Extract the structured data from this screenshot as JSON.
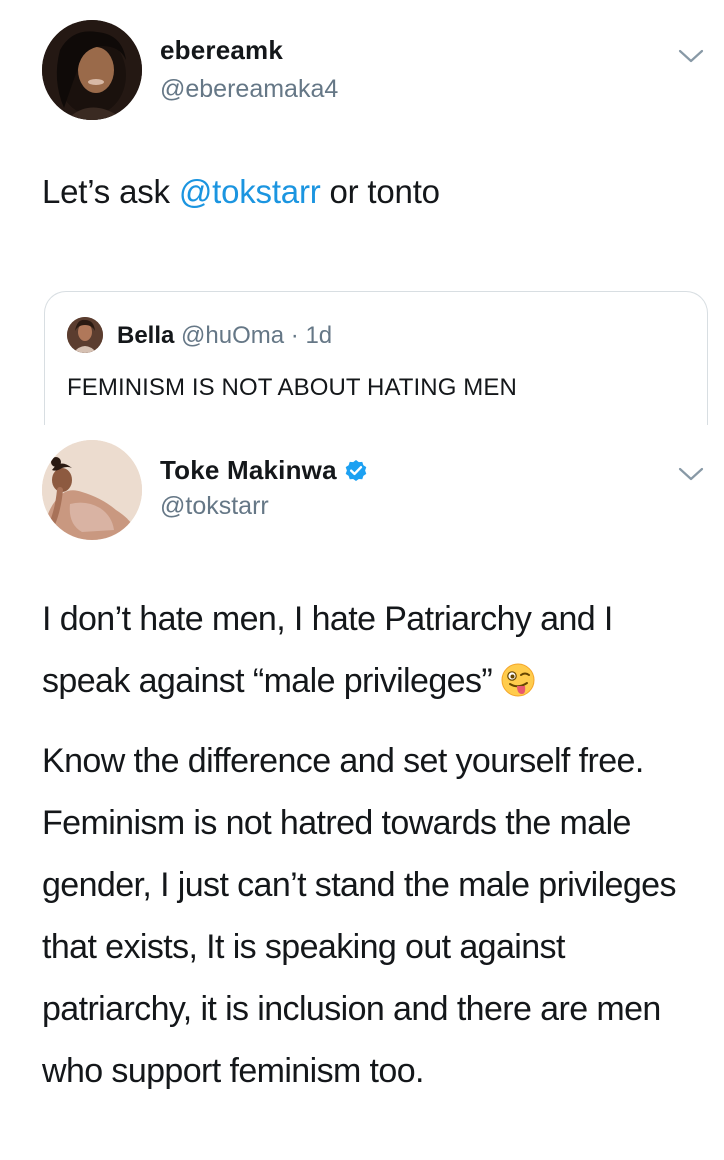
{
  "tweet1": {
    "display_name": "ebereamk",
    "handle": "@ebereamaka4",
    "text_before": "Let’s ask ",
    "mention": "@tokstarr",
    "text_after": " or tonto"
  },
  "quoted": {
    "display_name": "Bella",
    "handle_meta": "@huOma · 1d",
    "text": "FEMINISM IS NOT ABOUT HATING MEN"
  },
  "tweet2": {
    "display_name": "Toke Makinwa",
    "handle": "@tokstarr",
    "paragraph1": "I don’t hate men, I hate Patriarchy and I speak against “male privileges”",
    "paragraph2": "Know the difference and set yourself free. Feminism is not hatred towards the male gender, I just can’t stand the male privileges that exists, It is speaking out against patriarchy, it is inclusion and there are men who support feminism too."
  },
  "icons": {
    "caret": "chevron-down-icon",
    "verified": "verified-badge-icon",
    "emoji": "winking-face-with-tongue-emoji"
  },
  "colors": {
    "link": "#1b95e0",
    "secondary_text": "#657786",
    "primary_text": "#14171a",
    "border": "#d8dee2",
    "verified": "#1da1f2"
  }
}
